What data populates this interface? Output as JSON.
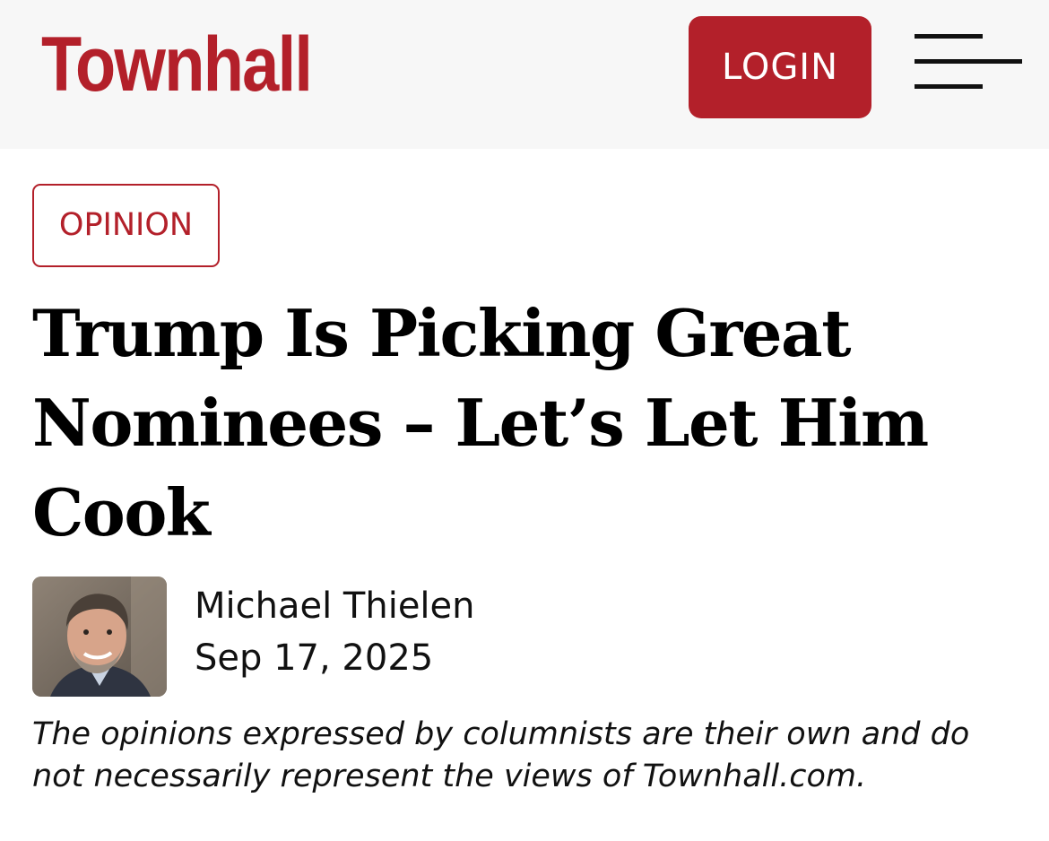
{
  "header": {
    "logo_text": "Townhall",
    "login_label": "LOGIN",
    "menu_icon": "hamburger-menu-icon",
    "brand_color": "#b3202a"
  },
  "article": {
    "category": "OPINION",
    "headline": "Trump Is Picking Great Nominees – Let’s Let Him Cook",
    "author": {
      "name": "Michael Thielen",
      "avatar": "author-photo"
    },
    "date": "Sep 17, 2025",
    "disclaimer": "The opinions expressed by columnists are their own and do not necessarily represent the views of Townhall.com."
  }
}
